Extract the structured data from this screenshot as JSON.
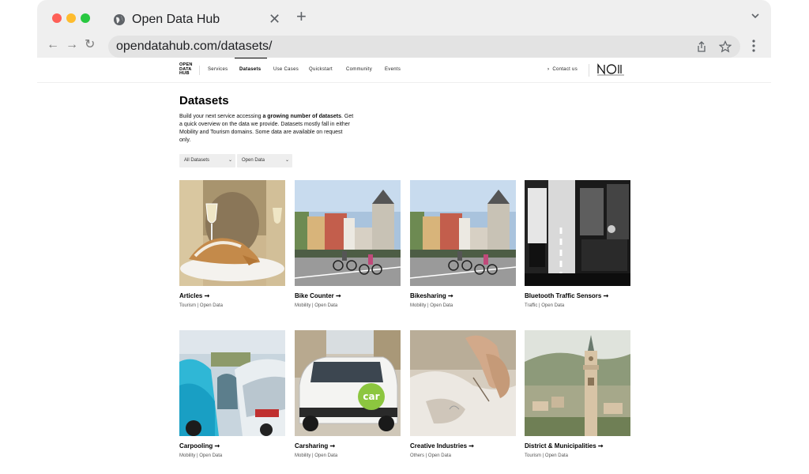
{
  "browser": {
    "tab_title": "Open Data Hub",
    "url": "opendatahub.com/datasets/"
  },
  "site": {
    "logo_lines": [
      "OPEN",
      "DATA",
      "HUB"
    ],
    "nav": [
      "Services",
      "Datasets",
      "Use Cases",
      "Quickstart",
      "Community",
      "Events"
    ],
    "active_nav": "Datasets",
    "contact": "Contact us"
  },
  "main": {
    "title": "Datasets",
    "intro_before": "Build your next service accessing ",
    "intro_bold": "a growing number of datasets",
    "intro_after": ". Get a quick overview on the data we provide. Datasets mostly fall in either Mobility and Tourism domains. Some data are available on request only.",
    "filters": [
      {
        "selected": "All Datasets"
      },
      {
        "selected": "Open Data"
      }
    ],
    "datasets": [
      {
        "title": "Articles ➞",
        "meta": "Tourism | Open Data"
      },
      {
        "title": "Bike Counter ➞",
        "meta": "Mobility | Open Data"
      },
      {
        "title": "Bikesharing ➞",
        "meta": "Mobility | Open Data"
      },
      {
        "title": "Bluetooth Traffic Sensors ➞",
        "meta": "Traffic | Open Data"
      },
      {
        "title": "Carpooling ➞",
        "meta": "Mobility | Open Data"
      },
      {
        "title": "Carsharing ➞",
        "meta": "Mobility | Open Data"
      },
      {
        "title": "Creative Industries ➞",
        "meta": "Others | Open Data"
      },
      {
        "title": "District & Municipalities ➞",
        "meta": "Tourism | Open Data"
      }
    ],
    "carsharing_badge": "car"
  }
}
